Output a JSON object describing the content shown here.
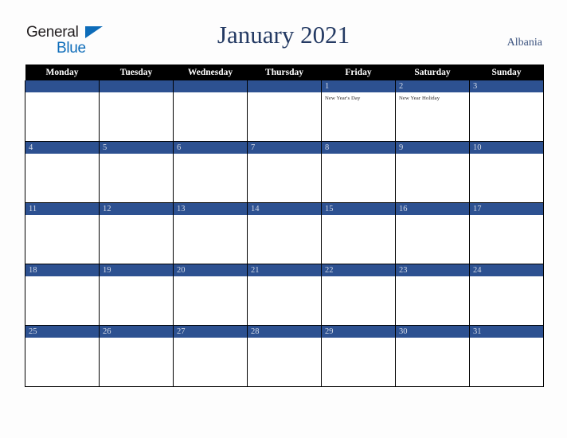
{
  "brand": {
    "name_part1": "General",
    "name_part2": "Blue",
    "color_dark": "#231f20",
    "color_blue": "#0d6cb9"
  },
  "header": {
    "title": "January 2021",
    "region": "Albania",
    "title_color": "#243a63"
  },
  "theme": {
    "accent_blue": "#2d5191",
    "header_row_bg": "#000000",
    "page_bg": "#fdfdfd",
    "day_number_color": "#d4dae7"
  },
  "calendar": {
    "weekday_headers": [
      "Monday",
      "Tuesday",
      "Wednesday",
      "Thursday",
      "Friday",
      "Saturday",
      "Sunday"
    ],
    "weeks": [
      [
        {
          "day": "",
          "holiday": ""
        },
        {
          "day": "",
          "holiday": ""
        },
        {
          "day": "",
          "holiday": ""
        },
        {
          "day": "",
          "holiday": ""
        },
        {
          "day": "1",
          "holiday": "New Year's Day"
        },
        {
          "day": "2",
          "holiday": "New Year Holiday"
        },
        {
          "day": "3",
          "holiday": ""
        }
      ],
      [
        {
          "day": "4",
          "holiday": ""
        },
        {
          "day": "5",
          "holiday": ""
        },
        {
          "day": "6",
          "holiday": ""
        },
        {
          "day": "7",
          "holiday": ""
        },
        {
          "day": "8",
          "holiday": ""
        },
        {
          "day": "9",
          "holiday": ""
        },
        {
          "day": "10",
          "holiday": ""
        }
      ],
      [
        {
          "day": "11",
          "holiday": ""
        },
        {
          "day": "12",
          "holiday": ""
        },
        {
          "day": "13",
          "holiday": ""
        },
        {
          "day": "14",
          "holiday": ""
        },
        {
          "day": "15",
          "holiday": ""
        },
        {
          "day": "16",
          "holiday": ""
        },
        {
          "day": "17",
          "holiday": ""
        }
      ],
      [
        {
          "day": "18",
          "holiday": ""
        },
        {
          "day": "19",
          "holiday": ""
        },
        {
          "day": "20",
          "holiday": ""
        },
        {
          "day": "21",
          "holiday": ""
        },
        {
          "day": "22",
          "holiday": ""
        },
        {
          "day": "23",
          "holiday": ""
        },
        {
          "day": "24",
          "holiday": ""
        }
      ],
      [
        {
          "day": "25",
          "holiday": ""
        },
        {
          "day": "26",
          "holiday": ""
        },
        {
          "day": "27",
          "holiday": ""
        },
        {
          "day": "28",
          "holiday": ""
        },
        {
          "day": "29",
          "holiday": ""
        },
        {
          "day": "30",
          "holiday": ""
        },
        {
          "day": "31",
          "holiday": ""
        }
      ]
    ]
  }
}
